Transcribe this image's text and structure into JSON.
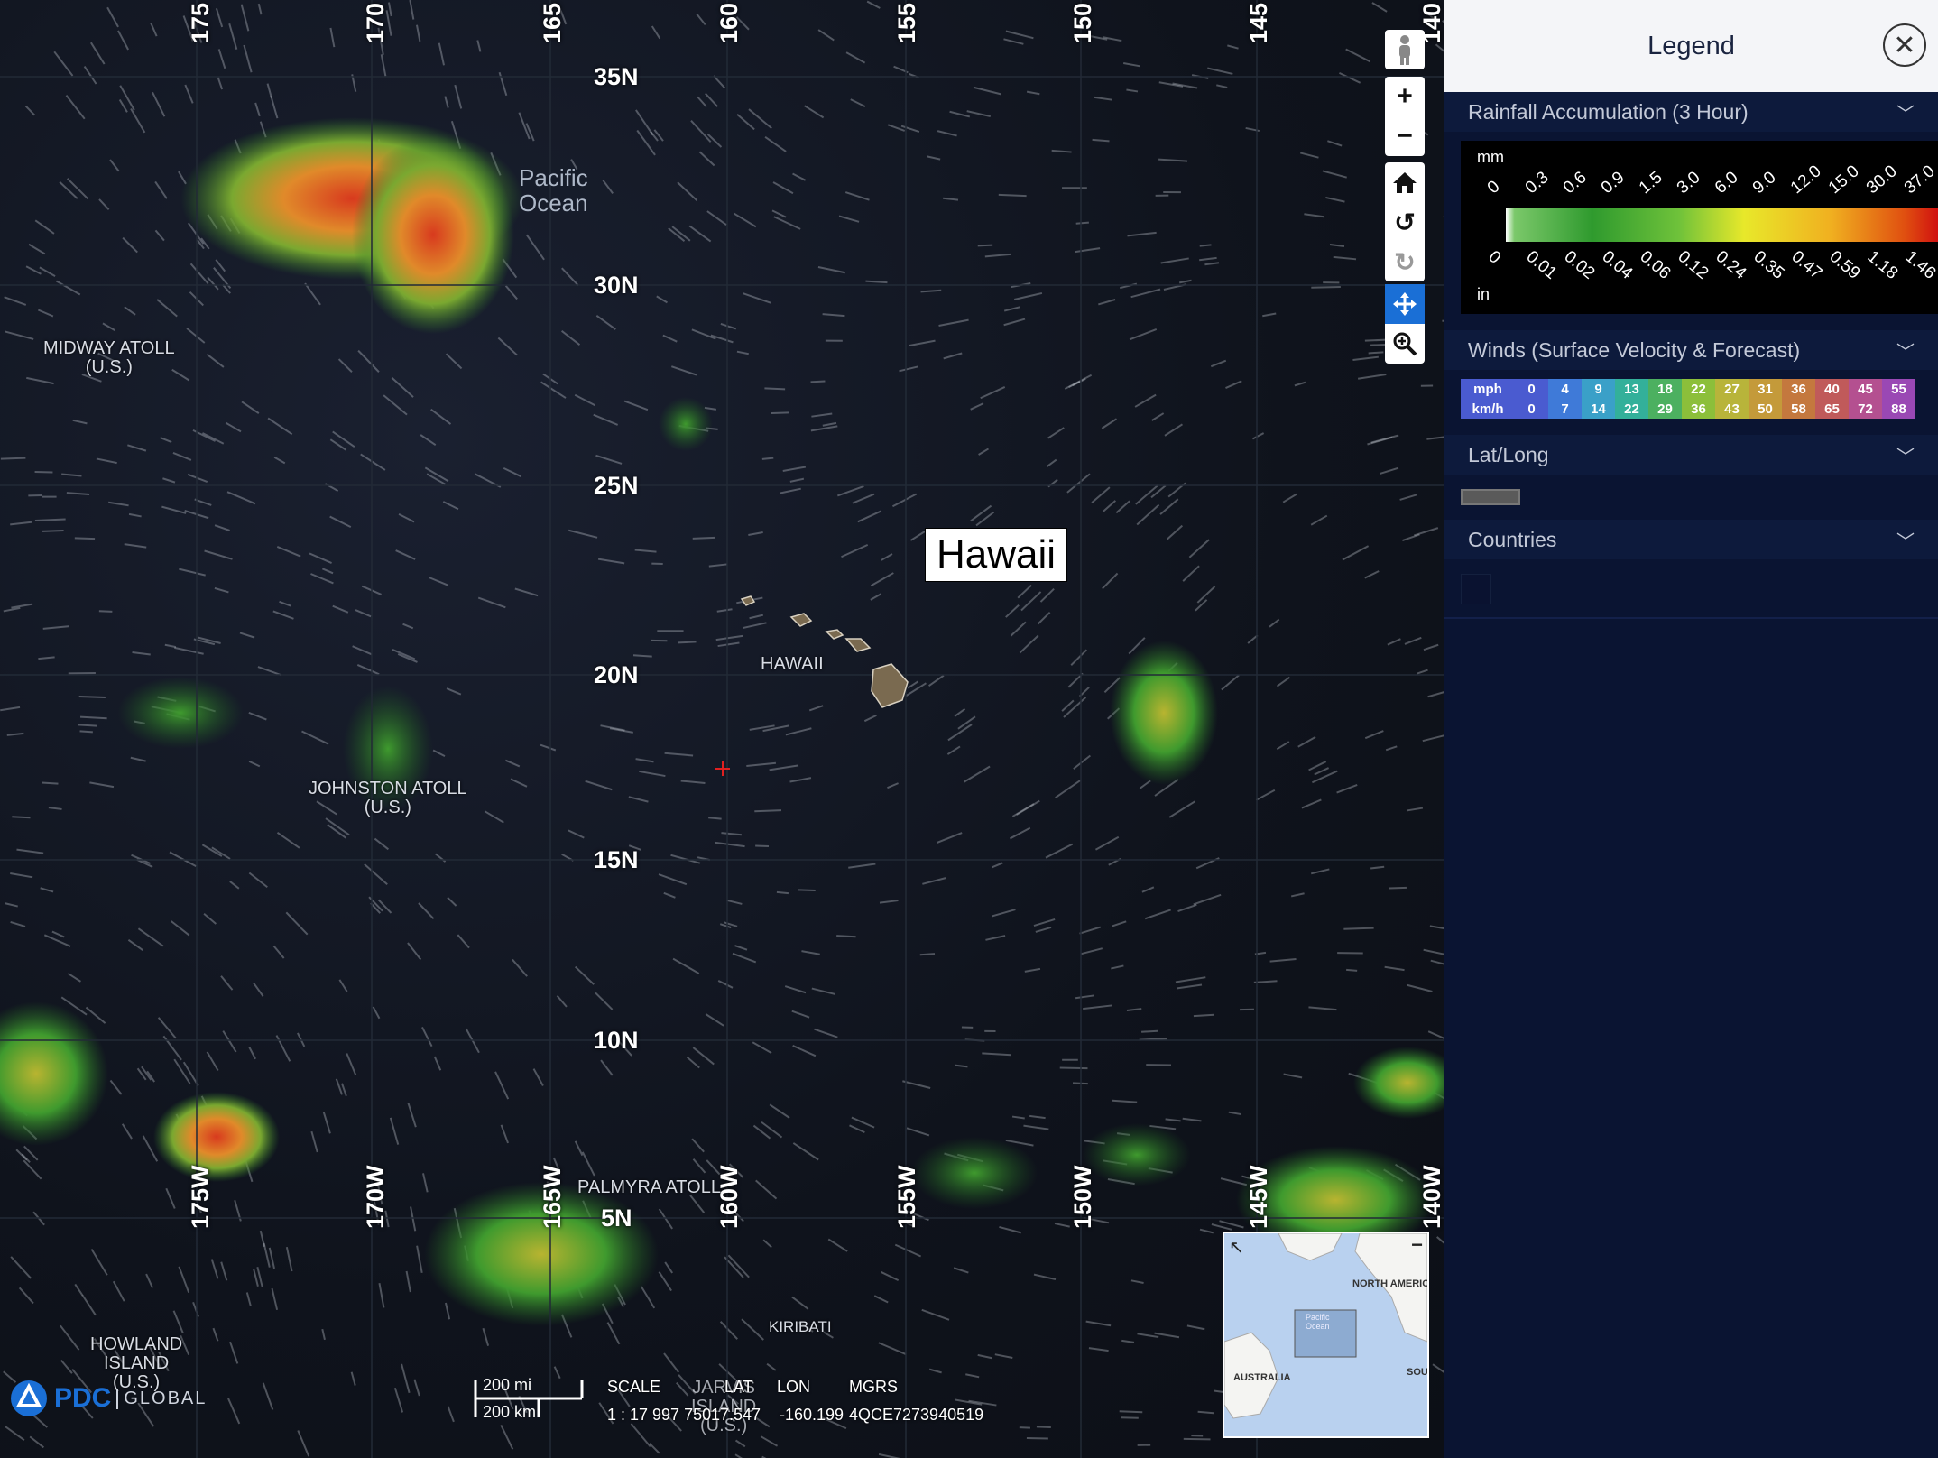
{
  "map": {
    "ocean_label": "Pacific\nOcean",
    "lat_labels": [
      "35N",
      "30N",
      "25N",
      "20N",
      "15N",
      "10N",
      "5N"
    ],
    "lon_labels_top": [
      "175",
      "170",
      "165",
      "160",
      "155",
      "150",
      "145",
      "140"
    ],
    "lon_labels_bottom": [
      "175W",
      "170W",
      "165W",
      "160W",
      "155W",
      "150W",
      "145W",
      "140W"
    ],
    "places": {
      "midway": "MIDWAY ATOLL\n(U.S.)",
      "hawaii_small": "HAWAII",
      "johnston": "JOHNSTON ATOLL\n(U.S.)",
      "palmyra": "PALMYRA ATOLL",
      "kiribati": "KIRIBATI",
      "howland": "HOWLAND\nISLAND\n(U.S.)",
      "jarvis": "JARVIS\nISLAND\n(U.S.)"
    },
    "hawaii_callout": "Hawaii",
    "logo_pdc": "PDC",
    "logo_global": "GLOBAL",
    "scale_mi": "200 mi",
    "scale_km": "200 km",
    "scale_label": "SCALE",
    "scale_value": "1 : 17 997 750",
    "lat_label": "LAT",
    "lat_value": "17.547",
    "lon_label": "LON",
    "lon_value": "-160.199",
    "mgrs_label": "MGRS",
    "mgrs_value": "4QCE7273940519",
    "minimap_labels": {
      "north_america": "NORTH AMERIC",
      "pacific": "Pacific\nOcean",
      "australia": "AUSTRALIA",
      "south": "SOU"
    }
  },
  "toolbar": {
    "icons": [
      "pegman-icon",
      "zoom-in-icon",
      "zoom-out-icon",
      "home-icon",
      "rotate-left-icon",
      "rotate-right-icon",
      "pan-icon",
      "zoom-box-icon"
    ],
    "active": "pan-icon"
  },
  "legend": {
    "title": "Legend",
    "rain": {
      "title": "Rainfall Accumulation (3 Hour)",
      "unit_top": "mm",
      "unit_bottom": "in",
      "mm_values": [
        "0",
        "0.3",
        "0.6",
        "0.9",
        "1.5",
        "3.0",
        "6.0",
        "9.0",
        "12.0",
        "15.0",
        "30.0",
        "37.0"
      ],
      "in_values": [
        "0",
        "0.01",
        "0.02",
        "0.04",
        "0.06",
        "0.12",
        "0.24",
        "0.35",
        "0.47",
        "0.59",
        "1.18",
        "1.46"
      ]
    },
    "winds": {
      "title": "Winds (Surface Velocity & Forecast)",
      "mph_label": "mph",
      "kmh_label": "km/h",
      "mph": [
        "0",
        "4",
        "9",
        "13",
        "18",
        "22",
        "27",
        "31",
        "36",
        "40",
        "45",
        "55"
      ],
      "kmh": [
        "0",
        "7",
        "14",
        "22",
        "29",
        "36",
        "43",
        "50",
        "58",
        "65",
        "72",
        "88"
      ],
      "colors": [
        "#4a5bd0",
        "#3f7ad8",
        "#3aa0c8",
        "#33b09a",
        "#4cb060",
        "#8cbf3a",
        "#b8b43a",
        "#c49a3a",
        "#c4783e",
        "#c05a5a",
        "#b45090",
        "#9a48b4"
      ]
    },
    "latlong": {
      "title": "Lat/Long"
    },
    "countries": {
      "title": "Countries"
    }
  }
}
